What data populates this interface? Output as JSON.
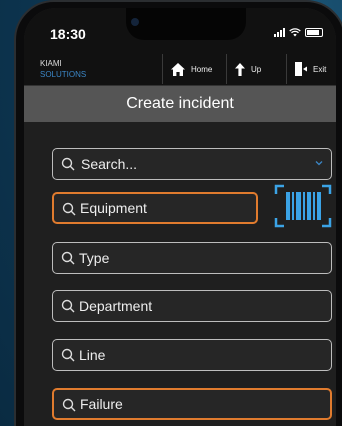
{
  "status_bar": {
    "time": "18:30"
  },
  "navbar": {
    "brand_line1": "KIAMI",
    "brand_line2": "SOLUTIONS",
    "home_label": "Home",
    "up_label": "Up",
    "exit_label": "Exit"
  },
  "page": {
    "title": "Create incident"
  },
  "search": {
    "placeholder": "Search..."
  },
  "fields": [
    {
      "label": "Equipment",
      "active": true
    },
    {
      "label": "Type",
      "active": false
    },
    {
      "label": "Department",
      "active": false
    },
    {
      "label": "Line",
      "active": false
    },
    {
      "label": "Failure",
      "active": true
    }
  ],
  "colors": {
    "accent_orange": "#e07b2e",
    "barcode_blue": "#3ba3e6",
    "brand_blue": "#3b86c6",
    "title_bar_gray": "#555555"
  },
  "icons": [
    "search-icon",
    "chevron-down-icon",
    "barcode-scanner-icon",
    "home-icon",
    "up-arrow-icon",
    "exit-door-icon"
  ]
}
